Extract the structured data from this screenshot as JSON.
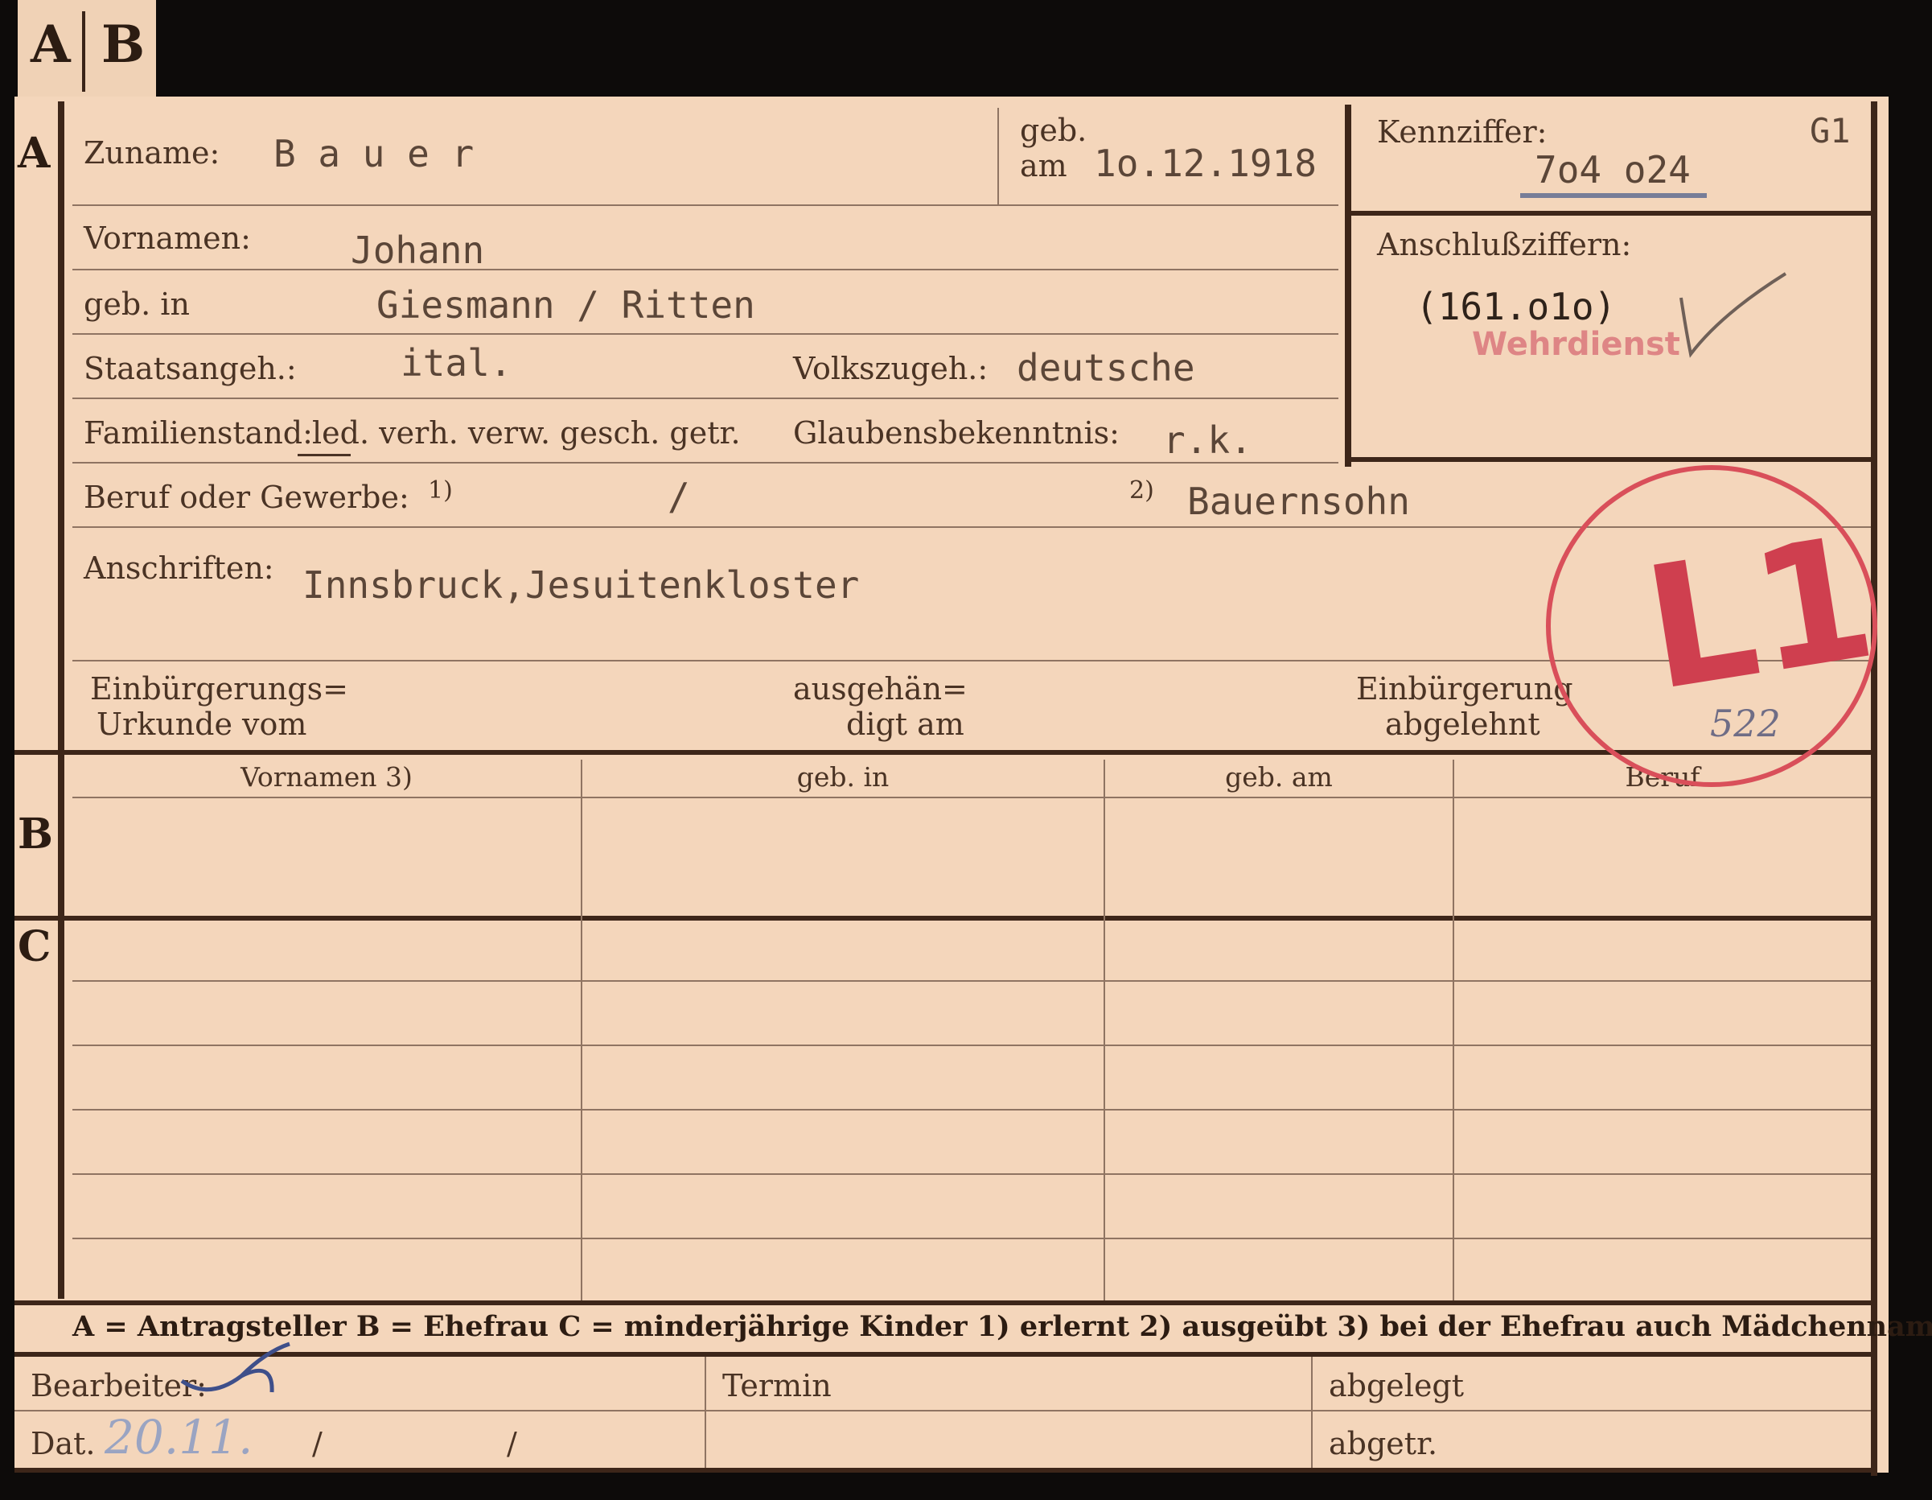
{
  "tabs": {
    "a": "A",
    "b": "B"
  },
  "sections": {
    "a": "A",
    "b": "B",
    "c": "C"
  },
  "section_a": {
    "surname_label": "Zuname:",
    "surname_value": "B a u e r",
    "born_label_1": "geb.",
    "born_label_2": "am",
    "born_date": "1o.12.1918",
    "kennziffer_label": "Kennziffer:",
    "kennziffer_code": "G1",
    "kennziffer_value": "7o4 o24",
    "anschluss_label": "Anschlußziffern:",
    "anschluss_value": "(161.o1o)",
    "anschluss_stamp": "Wehrdienst",
    "vornamen_label": "Vornamen:",
    "vornamen_value": "Johann",
    "geb_in_label": "geb. in",
    "geb_in_value": "Giesmann / Ritten",
    "staats_label": "Staatsangeh.:",
    "staats_value": "ital.",
    "volks_label": "Volkszugeh.:",
    "volks_value": "deutsche",
    "familien_label": "Familienstand:",
    "familien_options": "led. verh. verw. gesch. getr.",
    "glauben_label": "Glaubensbekenntnis:",
    "glauben_value": "r.k.",
    "beruf_label": "Beruf oder Gewerbe:",
    "beruf_1_marker": "1)",
    "beruf_1_value": "/",
    "beruf_2_marker": "2)",
    "beruf_2_value": "Bauernsohn",
    "anschriften_label": "Anschriften:",
    "anschriften_value": "Innsbruck,Jesuitenkloster",
    "einb_label_1": "Einbürgerungs=",
    "einb_label_2": "Urkunde vom",
    "ausgeh_label_1": "ausgehän=",
    "ausgeh_label_2": "digt am",
    "abgelehnt_label_1": "Einbürgerung",
    "abgelehnt_label_2": "abgelehnt"
  },
  "section_b": {
    "columns": [
      "Vornamen 3)",
      "geb. in",
      "geb. am",
      "Beruf"
    ]
  },
  "stamp": {
    "text": "L1",
    "number": "522"
  },
  "legend": "A = Antragsteller   B = Ehefrau   C = minderjährige Kinder   1) erlernt   2) ausgeübt   3) bei der Ehefrau auch Mädchenname",
  "footer": {
    "bearbeiter_label": "Bearbeiter:",
    "dat_label": "Dat.",
    "dat_value": "20.11.",
    "dat_slash_1": "/",
    "dat_slash_2": "/",
    "termin_label": "Termin",
    "abgelegt_label": "abgelegt",
    "abgetr_label": "abgetr."
  },
  "colors": {
    "paper": "#f4d6bb",
    "ink": "#4a3324",
    "stamp_red": "#cf3f4f",
    "pencil": "#6f6d86"
  }
}
